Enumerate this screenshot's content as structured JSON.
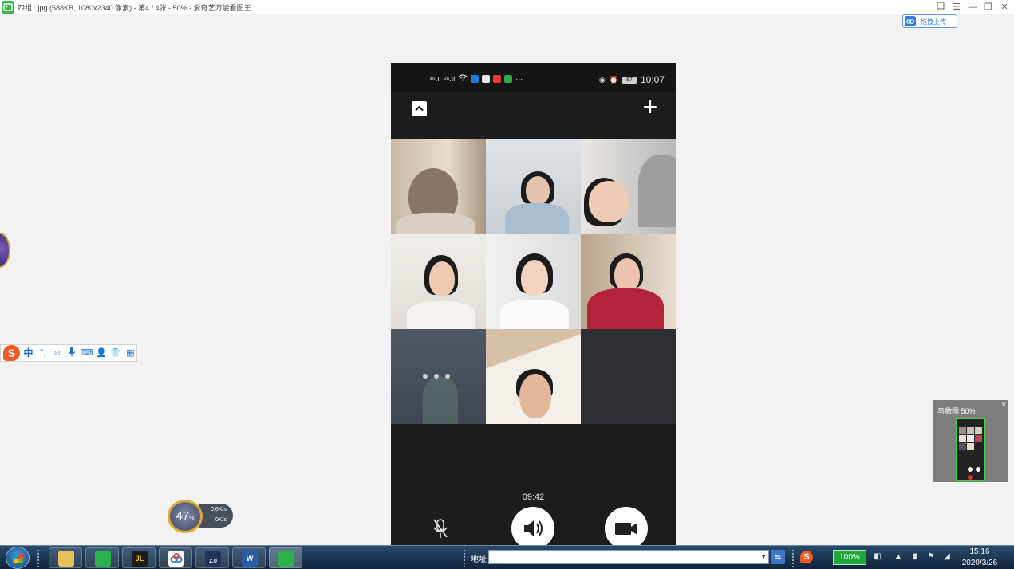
{
  "viewer": {
    "title": "四组1.jpg (588KB, 1080x2340 像素) - 第4 / 4张 - 50% - 爱奇艺万能看图王",
    "upload_label": "拖拽上传",
    "zoom_label": "鸟瞰图   50%"
  },
  "ime": {
    "lang": "中",
    "punct": "°,"
  },
  "phone": {
    "status": {
      "signal1": "⁴⁶.ıl",
      "signal2": "²⁶.ıl",
      "battery": "87",
      "time": "10:07",
      "more": "···"
    },
    "call_timer": "09:42"
  },
  "speed": {
    "percent": "47",
    "percent_unit": "%",
    "upload": "0.6K/s",
    "download": "0K/s"
  },
  "taskbar": {
    "address_label": "地址",
    "address_value": "",
    "battery": "100%",
    "time": "15:16",
    "date": "2020/3/26",
    "jl_label": "JL",
    "word_label": "W",
    "badge_label": "2.0"
  },
  "colors": {
    "accent_blue": "#2f7de1",
    "phone_bg": "#1c1c1c",
    "taskbar_green": "#1ea83a"
  }
}
